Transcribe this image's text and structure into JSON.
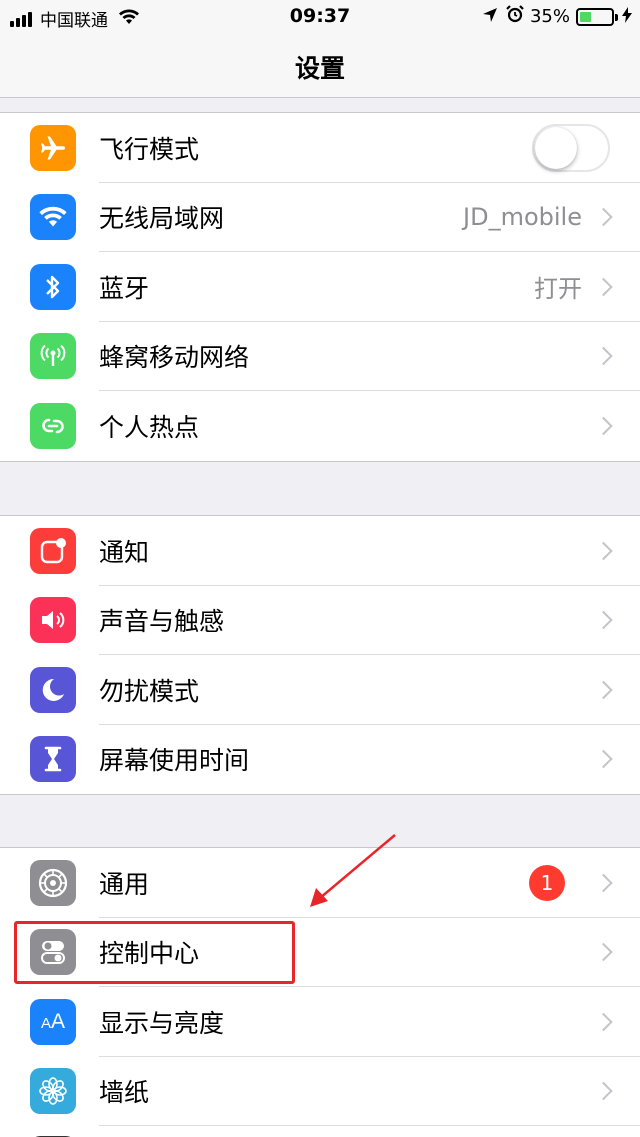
{
  "status_bar": {
    "carrier": "中国联通",
    "time": "09:37",
    "battery_percent": "35%",
    "battery_level": 0.35
  },
  "nav": {
    "title": "设置"
  },
  "groups": [
    {
      "items": [
        {
          "label": "飞行模式",
          "icon": "airplane-icon",
          "color": "#ff9500",
          "accessory": "toggle",
          "toggle_on": false
        },
        {
          "label": "无线局域网",
          "icon": "wifi-icon",
          "color": "#1a82fb",
          "value": "JD_mobile"
        },
        {
          "label": "蓝牙",
          "icon": "bluetooth-icon",
          "color": "#1a82fb",
          "value": "打开"
        },
        {
          "label": "蜂窝移动网络",
          "icon": "antenna-icon",
          "color": "#4cd964"
        },
        {
          "label": "个人热点",
          "icon": "hotspot-icon",
          "color": "#4cd964"
        }
      ]
    },
    {
      "items": [
        {
          "label": "通知",
          "icon": "notification-icon",
          "color": "#fc3d39"
        },
        {
          "label": "声音与触感",
          "icon": "speaker-icon",
          "color": "#fc3158"
        },
        {
          "label": "勿扰模式",
          "icon": "moon-icon",
          "color": "#5856d6"
        },
        {
          "label": "屏幕使用时间",
          "icon": "hourglass-icon",
          "color": "#5856d6"
        }
      ]
    },
    {
      "items": [
        {
          "label": "通用",
          "icon": "gear-icon",
          "color": "#8e8e93",
          "badge": "1"
        },
        {
          "label": "控制中心",
          "icon": "switches-icon",
          "color": "#8e8e93"
        },
        {
          "label": "显示与亮度",
          "icon": "text-size-icon",
          "color": "#1a82fb",
          "icon_text": "AA"
        },
        {
          "label": "墙纸",
          "icon": "flower-icon",
          "color": "#35aadc"
        }
      ]
    }
  ]
}
